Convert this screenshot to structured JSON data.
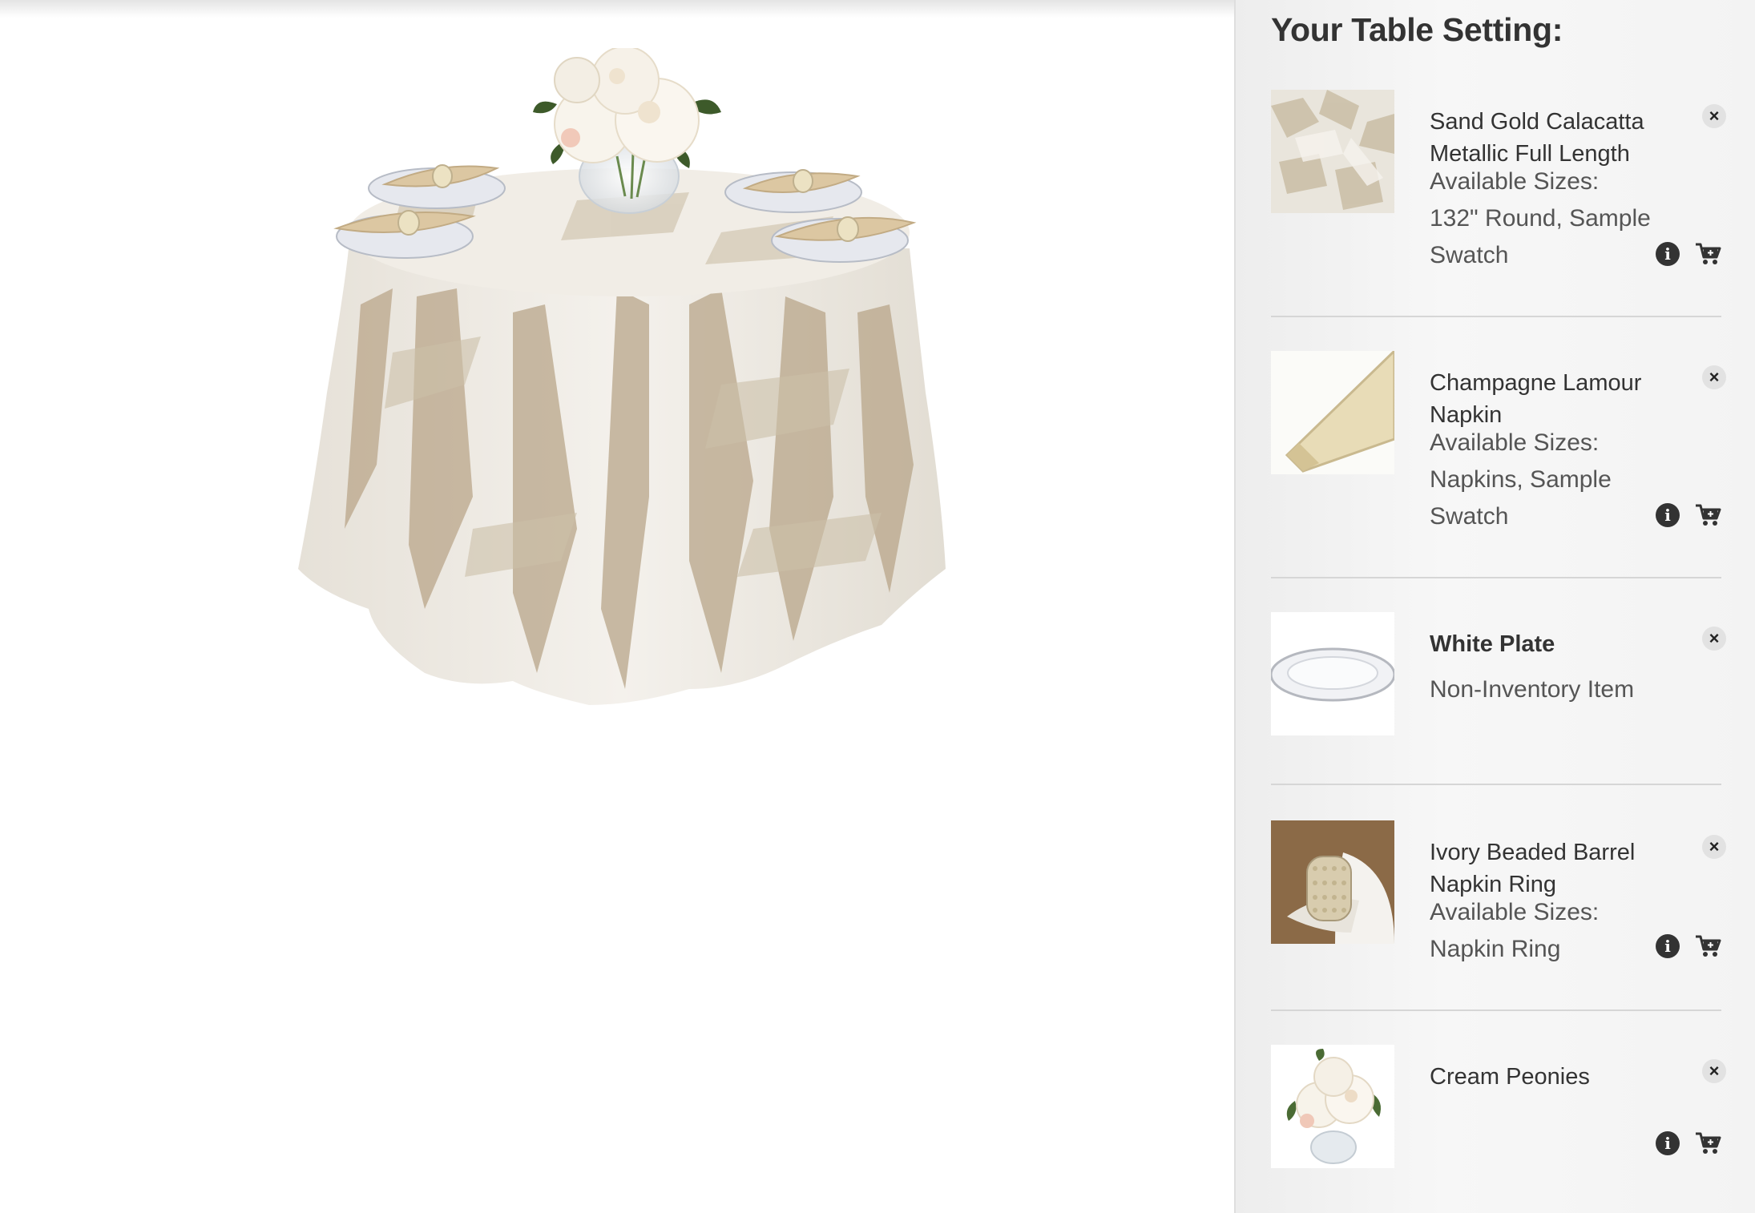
{
  "panel": {
    "title": "Your Table Setting:"
  },
  "items": [
    {
      "name": "Sand Gold Calacatta Metallic Full Length",
      "sizes_label": "Available Sizes:",
      "sizes_value": "132\" Round, Sample Swatch",
      "thumb_icon": "marble-swatch"
    },
    {
      "name": "Champagne Lamour Napkin",
      "sizes_label": "Available Sizes:",
      "sizes_value": "Napkins, Sample Swatch",
      "thumb_icon": "folded-napkin"
    },
    {
      "name": "White Plate",
      "note": "Non-Inventory Item",
      "thumb_icon": "white-plate"
    },
    {
      "name": "Ivory Beaded Barrel Napkin Ring",
      "sizes_label": "Available Sizes:",
      "sizes_value": "Napkin Ring",
      "thumb_icon": "beaded-napkin-ring"
    },
    {
      "name": "Cream Peonies",
      "thumb_icon": "peony-vase"
    }
  ],
  "icons": {
    "remove": "close-icon",
    "info": "info-icon",
    "cart": "add-to-cart-icon"
  },
  "colors": {
    "panel_bg": "#f2f2f2",
    "text": "#333333",
    "cloth_base": "#ece7df",
    "cloth_gold": "#b7a58a"
  }
}
